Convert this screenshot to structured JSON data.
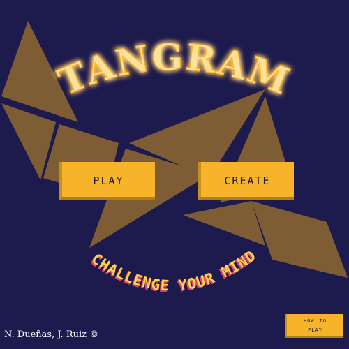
{
  "title": "TANGRAM",
  "tagline": "CHALLENGE YOUR MIND",
  "menu": {
    "play_label": "PLAY",
    "create_label": "CREATE",
    "how_to_play_line1": "HOW TO",
    "how_to_play_line2": "PLAY"
  },
  "credit": "N. Dueñas, J. Ruiz ©",
  "colors": {
    "background": "#1d1b4e",
    "tangram_piece": "#7f5d34",
    "button": "#f7b42b",
    "title_glow": "#ffb020"
  }
}
